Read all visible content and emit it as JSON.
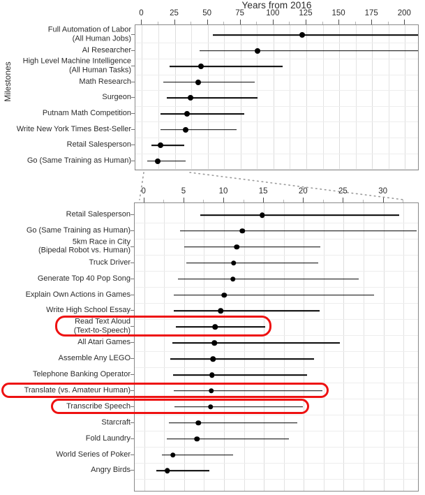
{
  "chart_data": {
    "type": "scatter",
    "title": "Years from 2016",
    "xlabel": "Years from 2016",
    "ylabel": "Milestones",
    "grid": true,
    "legend": null,
    "panels": [
      {
        "name": "overview-panel",
        "xlim": [
          -5,
          211
        ],
        "xticks": [
          0,
          25,
          50,
          75,
          100,
          125,
          150,
          175,
          200
        ],
        "xticklabels": [
          "0",
          "25",
          "50",
          "75",
          "100",
          "125",
          "150",
          "175",
          "200"
        ],
        "rows": [
          {
            "label": "Full Automation of Labor\n(All Human Jobs)",
            "value": 122,
            "low": 54,
            "high": 211,
            "highlighted": false
          },
          {
            "label": "AI Researcher",
            "value": 88,
            "low": 44,
            "high": 211,
            "highlighted": false
          },
          {
            "label": "High Level Machine Intelligence\n(All Human Tasks)",
            "value": 45,
            "low": 21,
            "high": 107,
            "highlighted": false
          },
          {
            "label": "Math Research",
            "value": 43,
            "low": 16,
            "high": 86,
            "highlighted": false
          },
          {
            "label": "Surgeon",
            "value": 37,
            "low": 19,
            "high": 88,
            "highlighted": false
          },
          {
            "label": "Putnam Math Competition",
            "value": 34,
            "low": 14,
            "high": 78,
            "highlighted": false
          },
          {
            "label": "Write New York Times Best-Seller",
            "value": 33,
            "low": 14,
            "high": 72,
            "highlighted": false
          },
          {
            "label": "Retail Salesperson",
            "value": 14,
            "low": 7,
            "high": 32,
            "highlighted": false
          },
          {
            "label": "Go (Same Training as Human)",
            "value": 12,
            "low": 4,
            "high": 33,
            "highlighted": false
          }
        ]
      },
      {
        "name": "detail-panel",
        "xlim": [
          -1.2,
          34.5
        ],
        "xticks": [
          0,
          5,
          10,
          15,
          20,
          25,
          30
        ],
        "xticklabels": [
          "0",
          "5",
          "10",
          "15",
          "20",
          "25",
          "30"
        ],
        "rows": [
          {
            "label": "Retail Salesperson",
            "value": 14.8,
            "low": 7.0,
            "high": 32.0,
            "highlighted": false
          },
          {
            "label": "Go (Same Training as Human)",
            "value": 12.3,
            "low": 4.5,
            "high": 34.2,
            "highlighted": false
          },
          {
            "label": "5km Race in City\n(Bipedal Robot vs. Human)",
            "value": 11.6,
            "low": 5.0,
            "high": 22.1,
            "highlighted": false
          },
          {
            "label": "Truck Driver",
            "value": 11.2,
            "low": 5.3,
            "high": 21.8,
            "highlighted": false
          },
          {
            "label": "Generate Top 40 Pop Song",
            "value": 11.1,
            "low": 4.2,
            "high": 26.9,
            "highlighted": false
          },
          {
            "label": "Explain Own Actions in Games",
            "value": 10.0,
            "low": 3.7,
            "high": 28.8,
            "highlighted": false
          },
          {
            "label": "Write High School Essay",
            "value": 9.6,
            "low": 3.7,
            "high": 22.0,
            "highlighted": false
          },
          {
            "label": "Read Text Aloud\n(Text-to-Speech)",
            "value": 8.9,
            "low": 4.0,
            "high": 15.2,
            "highlighted": true
          },
          {
            "label": "All Atari Games",
            "value": 8.8,
            "low": 3.5,
            "high": 24.5,
            "highlighted": false
          },
          {
            "label": "Assemble Any LEGO",
            "value": 8.6,
            "low": 3.3,
            "high": 21.3,
            "highlighted": false
          },
          {
            "label": "Telephone Banking Operator",
            "value": 8.5,
            "low": 3.6,
            "high": 20.4,
            "highlighted": false
          },
          {
            "label": "Translate (vs. Amateur Human)",
            "value": 8.4,
            "low": 3.7,
            "high": 22.3,
            "highlighted": true
          },
          {
            "label": "Transcribe Speech",
            "value": 8.3,
            "low": 3.8,
            "high": 19.9,
            "highlighted": true
          },
          {
            "label": "Starcraft",
            "value": 6.8,
            "low": 3.1,
            "high": 19.2,
            "highlighted": false
          },
          {
            "label": "Fold Laundry",
            "value": 6.6,
            "low": 2.8,
            "high": 18.1,
            "highlighted": false
          },
          {
            "label": "World Series of Poker",
            "value": 3.6,
            "low": 2.2,
            "high": 11.1,
            "highlighted": false
          },
          {
            "label": "Angry Birds",
            "value": 2.9,
            "low": 1.5,
            "high": 8.2,
            "highlighted": false
          }
        ]
      }
    ]
  },
  "colors": {
    "highlight": "#ee1111",
    "point": "#000000",
    "grid": "#e3e3e3",
    "panel_border": "#888888",
    "text": "#2b2b2b"
  }
}
